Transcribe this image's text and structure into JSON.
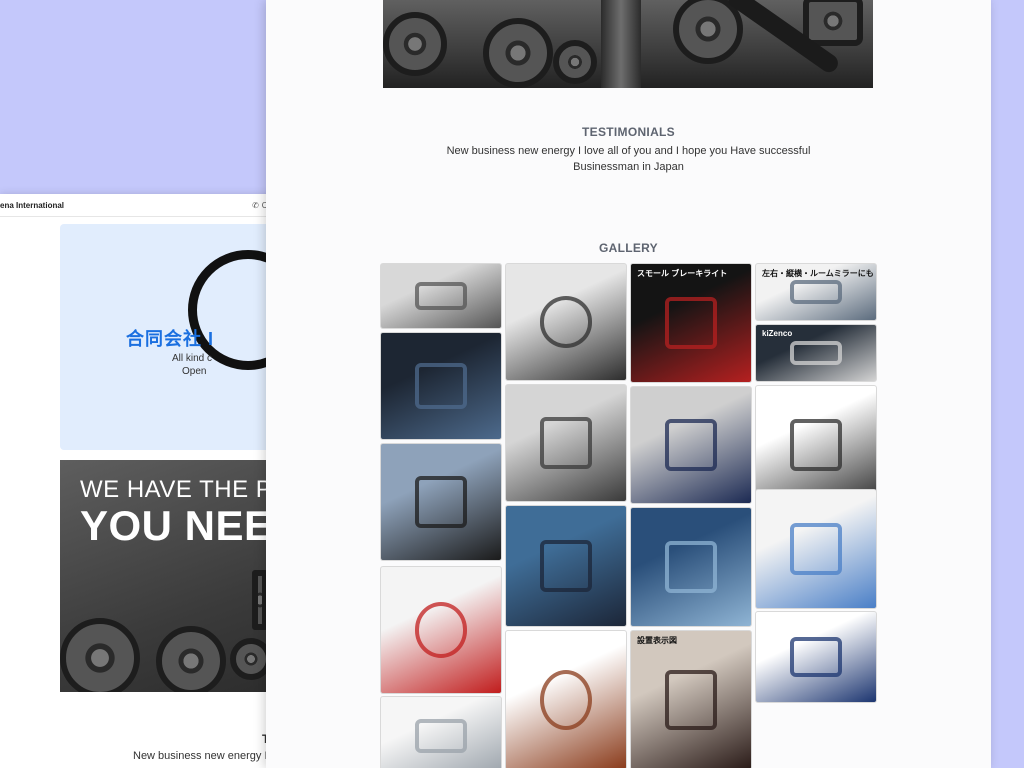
{
  "back_window": {
    "brand": "ena International",
    "contact_label": "Co",
    "company_name": "合同会社 I",
    "company_sub_1": "All kind c",
    "company_sub_2": "Open",
    "banner_line1": "WE HAVE THE PARTS",
    "banner_line2": "YOU NEED",
    "testimonials_title": "T",
    "testimonial_text": "New business new energy I lo"
  },
  "front_window": {
    "testimonials_title": "TESTIMONIALS",
    "testimonial_text": "New business new energy I love all of you and I hope you Have successful Businessman in Japan",
    "gallery_title": "GALLERY",
    "gallery_tiles": [
      {
        "name": "floor-mats",
        "colors": [
          "#d8d8d8",
          "#555555"
        ]
      },
      {
        "name": "steering-wheel-carbon",
        "colors": [
          "#e6e6e6",
          "#2d2d2d"
        ]
      },
      {
        "name": "brake-light-sign",
        "colors": [
          "#141414",
          "#b52020"
        ],
        "caption": "スモール ブレーキライト"
      },
      {
        "name": "mirror-top",
        "colors": [
          "#f2f2f2",
          "#5b6b7d"
        ],
        "caption": "左右・縦横・ルームミラーにも"
      },
      {
        "name": "window-sunshade",
        "colors": [
          "#1d2633",
          "#4d6a8c"
        ]
      },
      {
        "name": "interior-trim-parts",
        "colors": [
          "#d5d5d5",
          "#3a3a3a"
        ]
      },
      {
        "name": "seat-covers",
        "colors": [
          "#cfcfcf",
          "#1c2a53"
        ]
      },
      {
        "name": "room-mirror",
        "colors": [
          "#262f3a",
          "#d4d4d4"
        ],
        "caption": "kiZenco"
      },
      {
        "name": "car-door",
        "colors": [
          "#8ea2ba",
          "#1b1b1b"
        ]
      },
      {
        "name": "air-humidifier",
        "colors": [
          "#3f6d97",
          "#1c2638"
        ]
      },
      {
        "name": "cup-holder-fan",
        "colors": [
          "#2a4f7a",
          "#8fb4d4"
        ]
      },
      {
        "name": "phone-holder",
        "colors": [
          "#ffffff",
          "#2d2d2d"
        ]
      },
      {
        "name": "red-triangle-light",
        "colors": [
          "#f4f4f4",
          "#c11d1d"
        ]
      },
      {
        "name": "steering-wheel-wood",
        "colors": [
          "#ffffff",
          "#8a3b1b"
        ]
      },
      {
        "name": "neck-pillow",
        "colors": [
          "#d2c8be",
          "#2a1b18"
        ],
        "caption": "設置表示図"
      },
      {
        "name": "seatbelt-guide",
        "colors": [
          "#f4f4f4",
          "#4a7fc7"
        ]
      },
      {
        "name": "muffler-tip",
        "colors": [
          "#f6f6f6",
          "#9aa2aa"
        ]
      },
      {
        "name": "blank-partial",
        "colors": [
          "#ffffff",
          "#1c3570"
        ]
      }
    ]
  }
}
